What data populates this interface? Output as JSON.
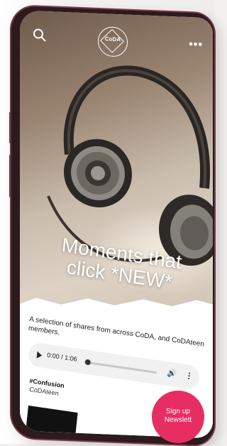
{
  "header": {
    "logo_text": "CoDA",
    "search_icon": "search-icon",
    "more_icon": "more-dots-icon",
    "more_text": "•••"
  },
  "hero": {
    "title_line1": "Moments that",
    "title_line2": "click *NEW*"
  },
  "content": {
    "intro": "A selection of shares from across CoDA, and CoDAteen members.",
    "player": {
      "time": "0:00 / 1:06",
      "play_icon": "play-icon",
      "volume_icon": "volume-icon",
      "volume_glyph": "🔊",
      "menu_icon": "more-vertical-icon",
      "menu_glyph": "⋮"
    },
    "tag": "#Confusion",
    "author": "CoDAteen"
  },
  "signup": {
    "line1": "Sign up",
    "line2": "Newslett"
  },
  "colors": {
    "accent": "#e82d63",
    "phone_frame": "#7a3a48"
  }
}
